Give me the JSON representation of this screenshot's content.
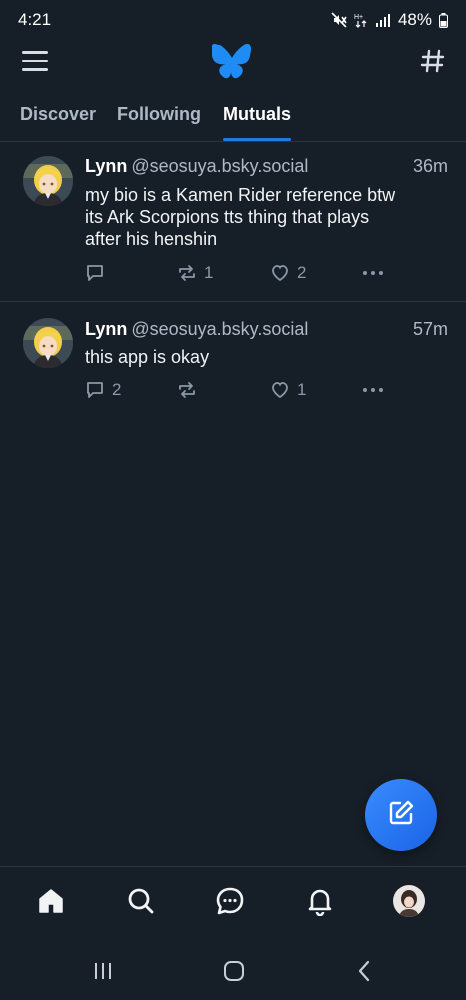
{
  "status_bar": {
    "time": "4:21",
    "battery": "48%",
    "icons": [
      "mute-icon",
      "data-arrows-icon",
      "signal-icon",
      "battery-icon"
    ]
  },
  "header": {
    "logo": "butterfly-logo",
    "menu_icon": "hamburger-icon",
    "feeds_icon": "hashtag-icon"
  },
  "tabs": [
    {
      "label": "Discover",
      "active": false
    },
    {
      "label": "Following",
      "active": false
    },
    {
      "label": "Mutuals",
      "active": true
    }
  ],
  "posts": [
    {
      "name": "Lynn",
      "handle": "@seosuya.bsky.social",
      "time": "36m",
      "text_lines": [
        "my bio is a Kamen Rider reference btw",
        "its Ark Scorpions tts thing that plays",
        "after his henshin"
      ],
      "replies": "",
      "reposts": "1",
      "likes": "2"
    },
    {
      "name": "Lynn",
      "handle": "@seosuya.bsky.social",
      "time": "57m",
      "text_lines": [
        "this app is okay"
      ],
      "replies": "2",
      "reposts": "",
      "likes": "1"
    }
  ],
  "bottom_nav": [
    "home-icon",
    "search-icon",
    "chat-icon",
    "bell-icon",
    "profile-avatar"
  ],
  "colors": {
    "background": "#161e27",
    "accent": "#1f7ae8",
    "muted_text": "#aeb9c6",
    "divider": "#2a3441"
  }
}
